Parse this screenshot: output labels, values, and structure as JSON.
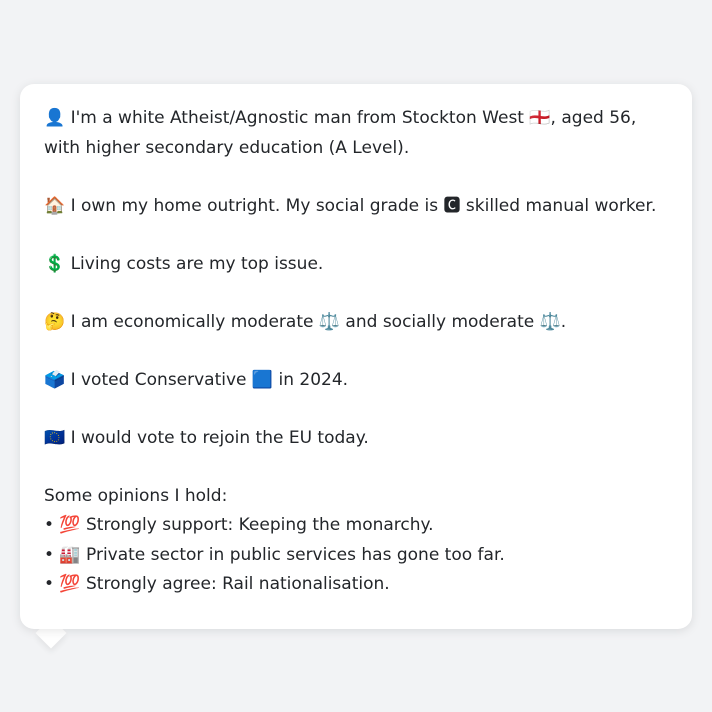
{
  "persona": {
    "identity": "👤 I'm a white Atheist/Agnostic man from Stockton West 🏴󠁧󠁢󠁥󠁮󠁧󠁿, aged 56, with higher secondary education (A Level).",
    "housing": "🏠 I own my home outright. My social grade is 🅲 skilled manual worker.",
    "top_issue": "💲 Living costs are my top issue.",
    "ideology": "🤔 I am economically moderate ⚖️ and socially moderate ⚖️.",
    "vote_2024": "🗳️ I voted Conservative 🟦 in 2024.",
    "eu": "🇪🇺 I would vote to rejoin the EU today."
  },
  "opinions": {
    "heading": "Some opinions I hold:",
    "items": [
      "• 💯 Strongly support: Keeping the monarchy.",
      "• 🏭 Private sector in public services has gone too far.",
      "• 💯 Strongly agree: Rail nationalisation."
    ]
  }
}
